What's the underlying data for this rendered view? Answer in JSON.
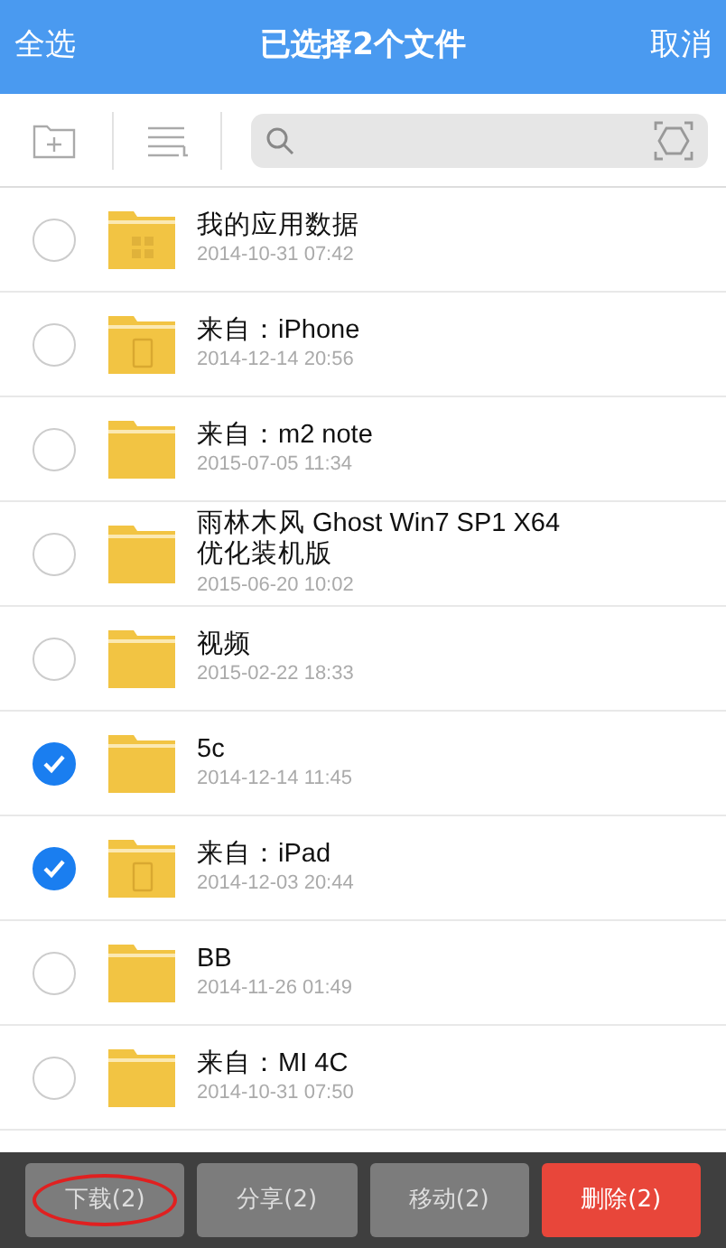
{
  "header": {
    "left": "全选",
    "title": "已选择2个文件",
    "right": "取消"
  },
  "files": [
    {
      "name": "我的应用数据",
      "date": "2014-10-31 07:42",
      "kind": "apps",
      "selected": false
    },
    {
      "name": "来自：iPhone",
      "date": "2014-12-14 20:56",
      "kind": "device",
      "selected": false
    },
    {
      "name": "来自：m2 note",
      "date": "2015-07-05 11:34",
      "kind": "plain",
      "selected": false
    },
    {
      "name": "雨林木风 Ghost Win7 SP1 X64 优化装机版",
      "date": "2015-06-20 10:02",
      "kind": "plain",
      "selected": false
    },
    {
      "name": "视频",
      "date": "2015-02-22 18:33",
      "kind": "plain",
      "selected": false
    },
    {
      "name": "5c",
      "date": "2014-12-14 11:45",
      "kind": "plain",
      "selected": true
    },
    {
      "name": "来自：iPad",
      "date": "2014-12-03 20:44",
      "kind": "device",
      "selected": true
    },
    {
      "name": "BB",
      "date": "2014-11-26 01:49",
      "kind": "plain",
      "selected": false
    },
    {
      "name": "来自：MI 4C",
      "date": "2014-10-31 07:50",
      "kind": "plain",
      "selected": false
    }
  ],
  "actions": [
    {
      "label": "下载(2)",
      "kind": "normal",
      "circled": true
    },
    {
      "label": "分享(2)",
      "kind": "normal",
      "circled": false
    },
    {
      "label": "移动(2)",
      "kind": "normal",
      "circled": false
    },
    {
      "label": "删除(2)",
      "kind": "danger",
      "circled": false
    }
  ]
}
